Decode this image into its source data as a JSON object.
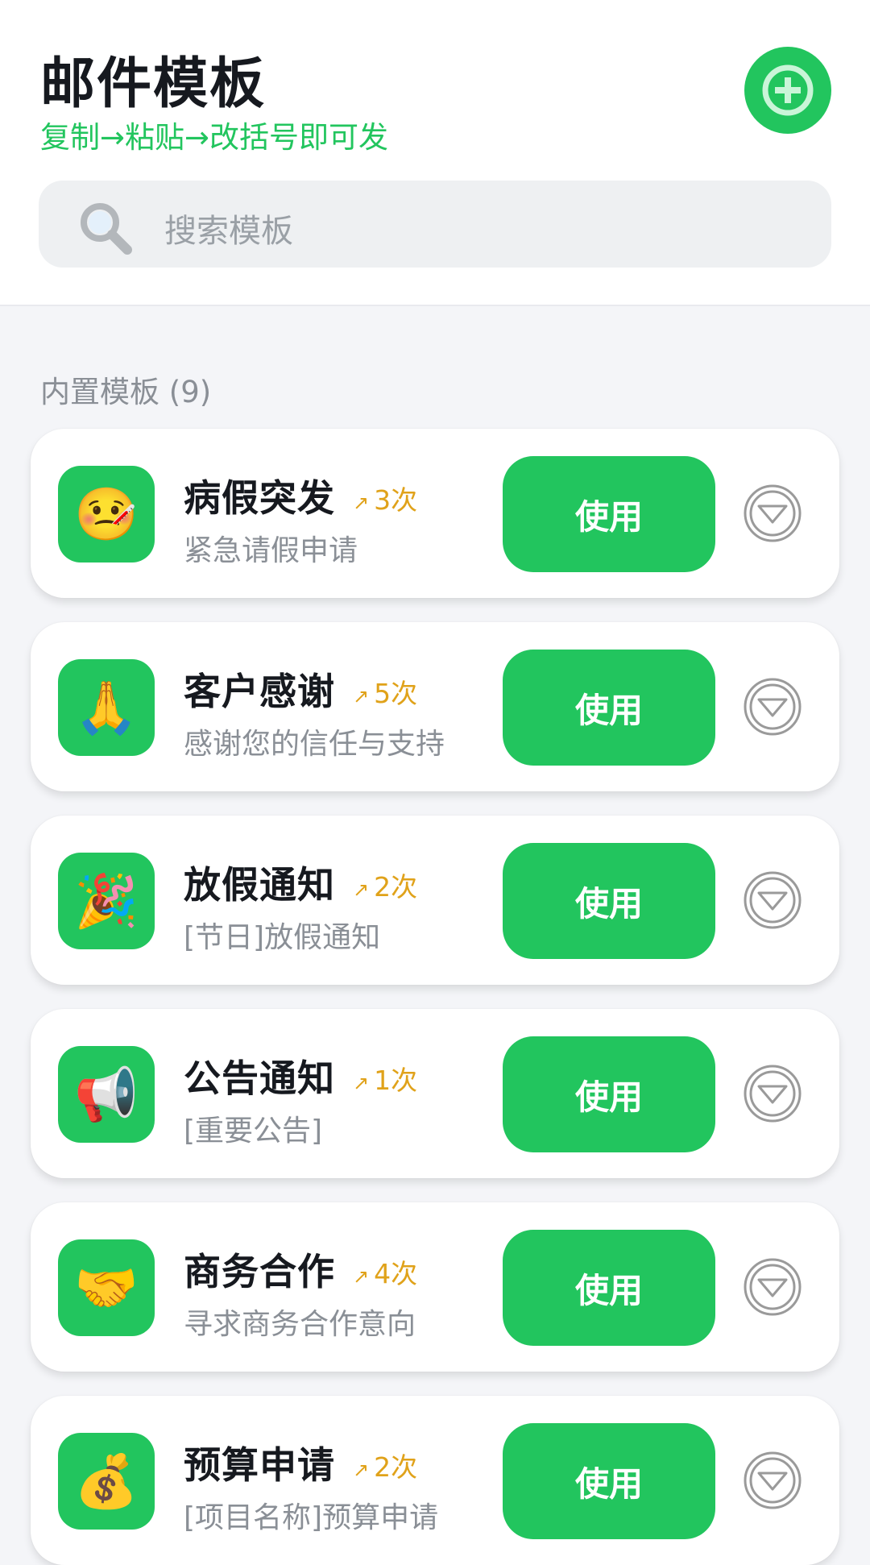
{
  "header": {
    "title": "邮件模板",
    "subtitle": "复制→粘贴→改括号即可发"
  },
  "search": {
    "placeholder": "搜索模板"
  },
  "section": {
    "label": "内置模板 (9)"
  },
  "colors": {
    "accent": "#22c55e",
    "usage": "#e0a21a",
    "background": "#f4f5f8"
  },
  "templates": [
    {
      "icon": "🤒",
      "icon_name": "face-with-thermometer-icon",
      "title": "病假突发",
      "usage_arrow": "↗",
      "usage": "3次",
      "desc": "紧急请假申请",
      "button": "使用"
    },
    {
      "icon": "🙏",
      "icon_name": "folded-hands-icon",
      "title": "客户感谢",
      "usage_arrow": "↗",
      "usage": "5次",
      "desc": "感谢您的信任与支持",
      "button": "使用"
    },
    {
      "icon": "🎉",
      "icon_name": "party-popper-icon",
      "title": "放假通知",
      "usage_arrow": "↗",
      "usage": "2次",
      "desc": "[节日]放假通知",
      "button": "使用"
    },
    {
      "icon": "📢",
      "icon_name": "megaphone-icon",
      "title": "公告通知",
      "usage_arrow": "↗",
      "usage": "1次",
      "desc": "[重要公告]",
      "button": "使用"
    },
    {
      "icon": "🤝",
      "icon_name": "handshake-icon",
      "title": "商务合作",
      "usage_arrow": "↗",
      "usage": "4次",
      "desc": "寻求商务合作意向",
      "button": "使用"
    },
    {
      "icon": "💰",
      "icon_name": "money-bag-icon",
      "title": "预算申请",
      "usage_arrow": "↗",
      "usage": "2次",
      "desc": "[项目名称]预算申请",
      "button": "使用"
    }
  ]
}
